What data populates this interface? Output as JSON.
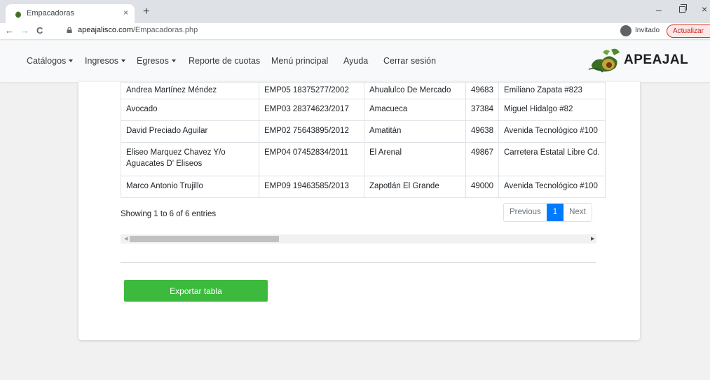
{
  "browser": {
    "tab_title": "Empacadoras",
    "tab_close": "×",
    "new_tab": "+",
    "url_host": "apeajalisco.com",
    "url_path": "/Empacadoras.php",
    "profile_label": "Invitado",
    "update_label": "Actualizar",
    "back_icon": "←",
    "forward_icon": "→",
    "reload_icon": "C",
    "win_min": "–",
    "win_close": "×"
  },
  "nav": {
    "items": [
      "Catálogos",
      "Ingresos",
      "Egresos",
      "Reporte de cuotas",
      "Menú principal",
      "Ayuda",
      "Cerrar sesión"
    ],
    "logo_text": "APEAJAL"
  },
  "table": {
    "rows": [
      [
        "Andrea Martínez Méndez",
        "EMP05 18375277/2002",
        "Ahualulco De Mercado",
        "49683",
        "Emiliano Zapata #823"
      ],
      [
        "Avocado",
        "EMP03 28374623/2017",
        "Amacueca",
        "37384",
        "Miguel Hidalgo #82"
      ],
      [
        "David Preciado Aguilar",
        "EMP02 75643895/2012",
        "Amatitán",
        "49638",
        "Avenida Tecnológico #100"
      ],
      [
        "Eliseo Marquez Chavez Y/o Aguacates D' Eliseos",
        "EMP04 07452834/2011",
        "El Arenal",
        "49867",
        "Carretera Estatal Libre Cd."
      ],
      [
        "Marco Antonio Trujillo",
        "EMP09 19463585/2013",
        "Zapotlán El Grande",
        "49000",
        "Avenida Tecnológico #100"
      ]
    ]
  },
  "info_text": "Showing 1 to 6 of 6 entries",
  "pagination": {
    "previous": "Previous",
    "page": "1",
    "next": "Next"
  },
  "export_label": "Exportar tabla",
  "colors": {
    "accent_green": "#3dba3d",
    "page_active": "#007bff"
  }
}
